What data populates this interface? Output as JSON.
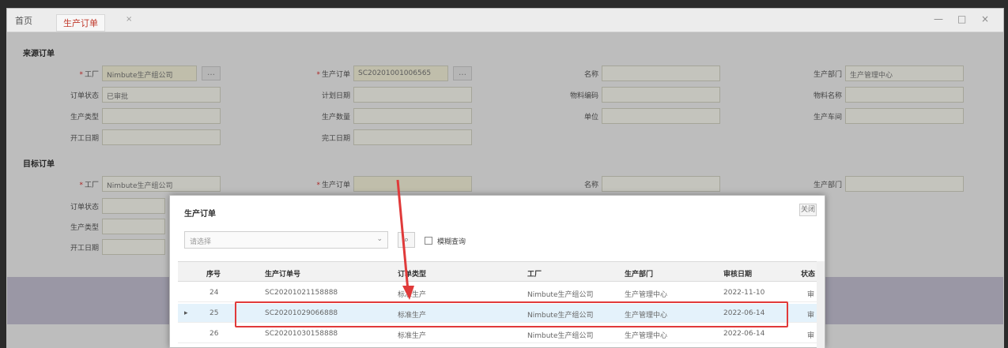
{
  "tabs": {
    "home": "首页",
    "active": "生产订单",
    "close": "×"
  },
  "window_controls": [
    "—",
    "□",
    "×"
  ],
  "section1": {
    "title": "来源订单"
  },
  "section2": {
    "title": "目标订单"
  },
  "fields1": [
    {
      "label": "工厂",
      "required": true,
      "value": "Nimbute生产组公司"
    },
    {
      "label": "生产订单",
      "required": true,
      "value": "SC20201001006565"
    },
    {
      "label": "名称",
      "value": ""
    },
    {
      "label": "生产部门",
      "value": "生产管理中心"
    },
    {
      "label": "订单状态",
      "value": "已审批"
    },
    {
      "label": "计划日期",
      "value": ""
    },
    {
      "label": "物料编码",
      "value": ""
    },
    {
      "label": "物料名称",
      "value": ""
    },
    {
      "label": "生产类型",
      "value": ""
    },
    {
      "label": "生产数量",
      "value": ""
    },
    {
      "label": "单位",
      "value": ""
    },
    {
      "label": "生产车间",
      "value": ""
    },
    {
      "label": "开工日期",
      "value": ""
    },
    {
      "label": "完工日期",
      "value": ""
    }
  ],
  "fields2": [
    {
      "label": "工厂",
      "required": true,
      "value": "Nimbute生产组公司"
    },
    {
      "label": "生产订单",
      "required": true,
      "value": ""
    },
    {
      "label": "名称",
      "value": ""
    },
    {
      "label": "生产部门",
      "value": ""
    },
    {
      "label": "订单状态",
      "value": ""
    },
    {
      "label": "生产类型",
      "value": ""
    },
    {
      "label": "开工日期",
      "value": ""
    }
  ],
  "dialog": {
    "title": "生产订单",
    "close": "关闭",
    "select_placeholder": "请选择",
    "search_icon": "⌕",
    "checkbox_label": "模糊查询",
    "columns": [
      "序号",
      "生产订单号",
      "订单类型",
      "工厂",
      "生产部门",
      "审核日期",
      "状态"
    ],
    "rows": [
      {
        "no": "24",
        "order": "SC20201021158888",
        "type": "标准生产",
        "factory": "Nimbute生产组公司",
        "dept": "生产管理中心",
        "date": "2022-11-10",
        "status": "审"
      },
      {
        "no": "25",
        "order": "SC20201029066888",
        "type": "标准生产",
        "factory": "Nimbute生产组公司",
        "dept": "生产管理中心",
        "date": "2022-06-14",
        "status": "审",
        "selected": true
      },
      {
        "no": "26",
        "order": "SC20201030158888",
        "type": "标准生产",
        "factory": "Nimbute生产组公司",
        "dept": "生产管理中心",
        "date": "2022-06-14",
        "status": "审"
      }
    ]
  },
  "colors": {
    "accent": "#c0392b",
    "highlight": "#e03a3a",
    "selected_row": "#e4f2fb"
  }
}
